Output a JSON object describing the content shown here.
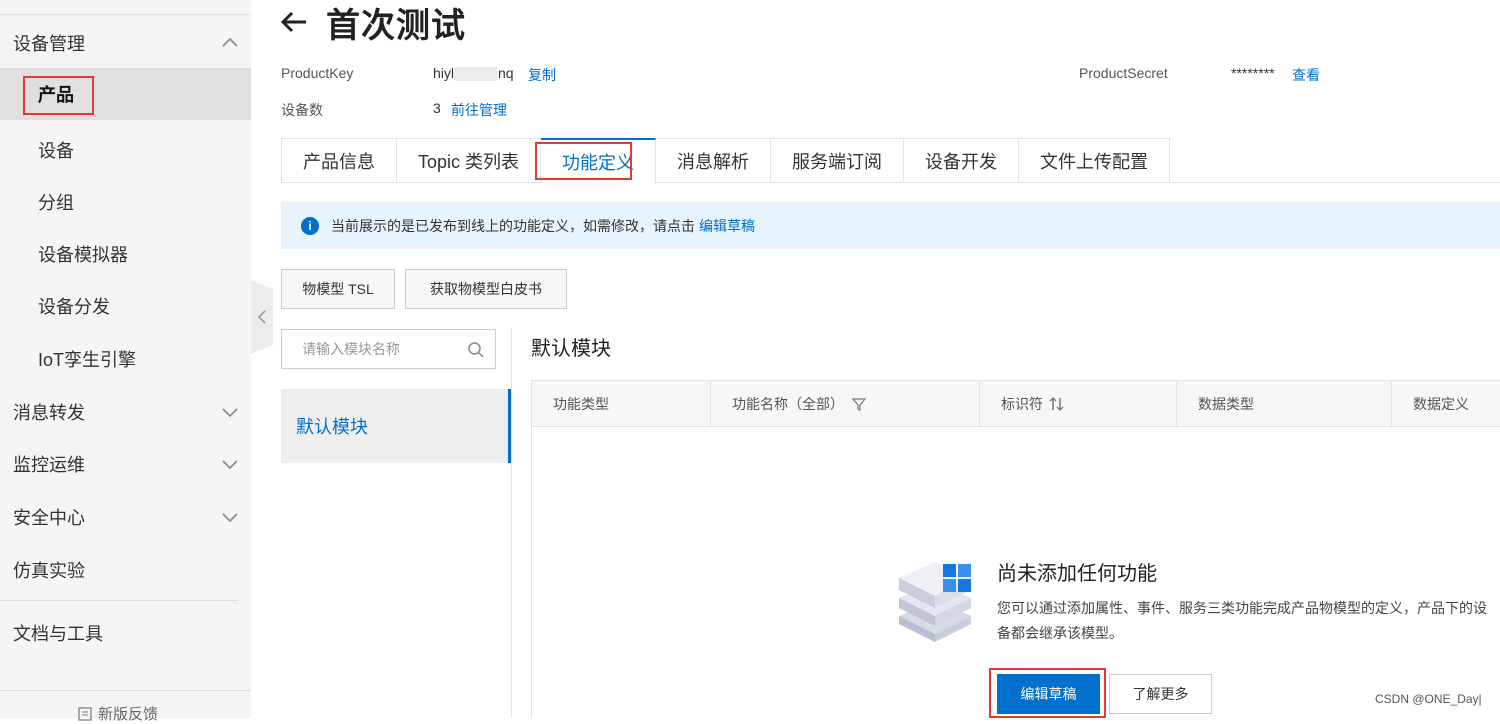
{
  "sidebar": {
    "items": [
      {
        "label": "设备管理"
      },
      {
        "label": "产品"
      },
      {
        "label": "设备"
      },
      {
        "label": "分组"
      },
      {
        "label": "设备模拟器"
      },
      {
        "label": "设备分发"
      },
      {
        "label": "IoT孪生引擎"
      },
      {
        "label": "消息转发"
      },
      {
        "label": "监控运维"
      },
      {
        "label": "安全中心"
      },
      {
        "label": "仿真实验"
      },
      {
        "label": "文档与工具"
      }
    ],
    "feedback": "新版反馈"
  },
  "header": {
    "title": "首次测试",
    "product_key_label": "ProductKey",
    "product_key_prefix": "hiyl",
    "product_key_suffix": "nq",
    "copy_link": "复制",
    "product_secret_label": "ProductSecret",
    "product_secret_value": "********",
    "view_link": "查看",
    "device_count_label": "设备数",
    "device_count_value": "3",
    "manage_link": "前往管理"
  },
  "tabs": [
    {
      "label": "产品信息"
    },
    {
      "label": "Topic 类列表"
    },
    {
      "label": "功能定义",
      "active": true
    },
    {
      "label": "消息解析"
    },
    {
      "label": "服务端订阅"
    },
    {
      "label": "设备开发"
    },
    {
      "label": "文件上传配置"
    }
  ],
  "info": {
    "text": "当前展示的是已发布到线上的功能定义，如需修改，请点击",
    "link": "编辑草稿"
  },
  "toolbar": {
    "tsl_button": "物模型 TSL",
    "whitepaper_button": "获取物模型白皮书"
  },
  "modules": {
    "search_placeholder": "请输入模块名称",
    "items": [
      {
        "label": "默认模块"
      }
    ]
  },
  "main": {
    "section_title": "默认模块",
    "columns": [
      "功能类型",
      "功能名称（全部）",
      "标识符",
      "数据类型",
      "数据定义"
    ],
    "empty": {
      "title": "尚未添加任何功能",
      "description": "您可以通过添加属性、事件、服务三类功能完成产品物模型的定义，产品下的设备都会继承该模型。",
      "edit_button": "编辑草稿",
      "learn_button": "了解更多"
    }
  },
  "watermark": "CSDN @ONE_Day|",
  "colors": {
    "accent": "#0070cc",
    "highlight": "#e53935",
    "info_bg": "#e7f3fd"
  }
}
